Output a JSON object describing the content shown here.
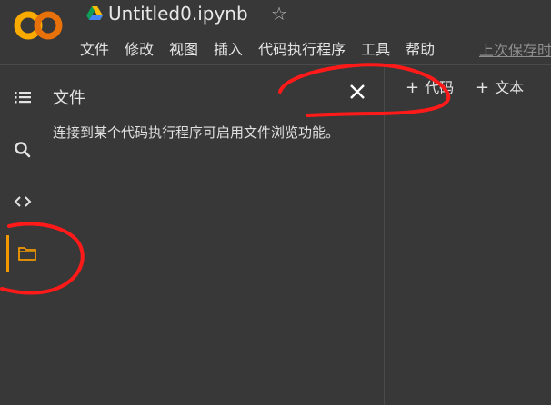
{
  "header": {
    "logo_text": "CO",
    "file_title": "Untitled0.ipynb",
    "star_icon": "☆",
    "menu": [
      "文件",
      "修改",
      "视图",
      "插入",
      "代码执行程序",
      "工具",
      "帮助"
    ],
    "last_saved": "上次保存时"
  },
  "sidebar": {
    "icons": [
      "toc-icon",
      "search-icon",
      "code-icon",
      "folder-icon"
    ],
    "active_color": "#f29900"
  },
  "panel": {
    "title": "文件",
    "message": "连接到某个代码执行程序可启用文件浏览功能。"
  },
  "toolbar": {
    "add_code_label": "代码",
    "add_text_label": "文本",
    "plus": "+"
  },
  "annotation_color": "#ff1a1a"
}
